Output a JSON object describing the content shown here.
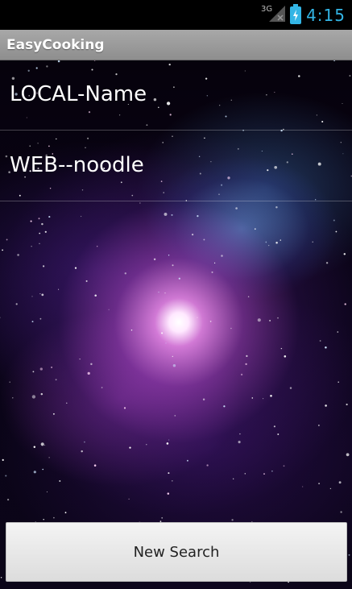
{
  "status_bar": {
    "network": "3G",
    "time": "4:15",
    "icons": [
      "signal-icon",
      "battery-charging-icon"
    ],
    "accent_color": "#33b5e5"
  },
  "action_bar": {
    "title": "EasyCooking"
  },
  "list": {
    "items": [
      {
        "label": "LOCAL-Name"
      },
      {
        "label": "WEB--noodle"
      }
    ]
  },
  "buttons": {
    "new_search_label": "New Search"
  }
}
